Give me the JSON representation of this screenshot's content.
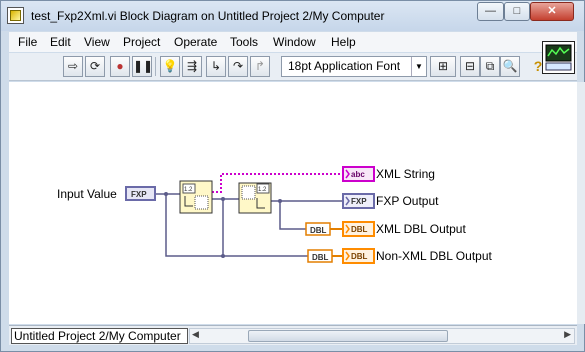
{
  "window": {
    "title": "test_Fxp2Xml.vi Block Diagram on Untitled Project 2/My Computer",
    "minimize_glyph": "—",
    "maximize_glyph": "□",
    "close_glyph": "✕"
  },
  "menu": [
    "File",
    "Edit",
    "View",
    "Project",
    "Operate",
    "Tools",
    "Window",
    "Help"
  ],
  "toolbar": {
    "font": "18pt Application Font",
    "help_glyph": "?"
  },
  "diagram": {
    "input_label": "Input Value",
    "input_type": "FXP",
    "outputs": {
      "xml_string": "XML String",
      "fxp_output": "FXP Output",
      "xml_dbl_output": "XML DBL Output",
      "nonxml_dbl_output": "Non-XML DBL Output"
    },
    "type_tags": {
      "abc": "abc",
      "fxp": "FXP",
      "dbl": "DBL",
      "node_tag": "1.2"
    },
    "colors": {
      "fxp_wire": "#5c5c8a",
      "string_wire": "#cc00cc",
      "dbl_terminal": "#ff8c00",
      "fxp_terminal": "#6a6aa8",
      "string_terminal": "#cc00cc"
    }
  },
  "status": {
    "project": "Untitled Project 2/My Computer"
  }
}
